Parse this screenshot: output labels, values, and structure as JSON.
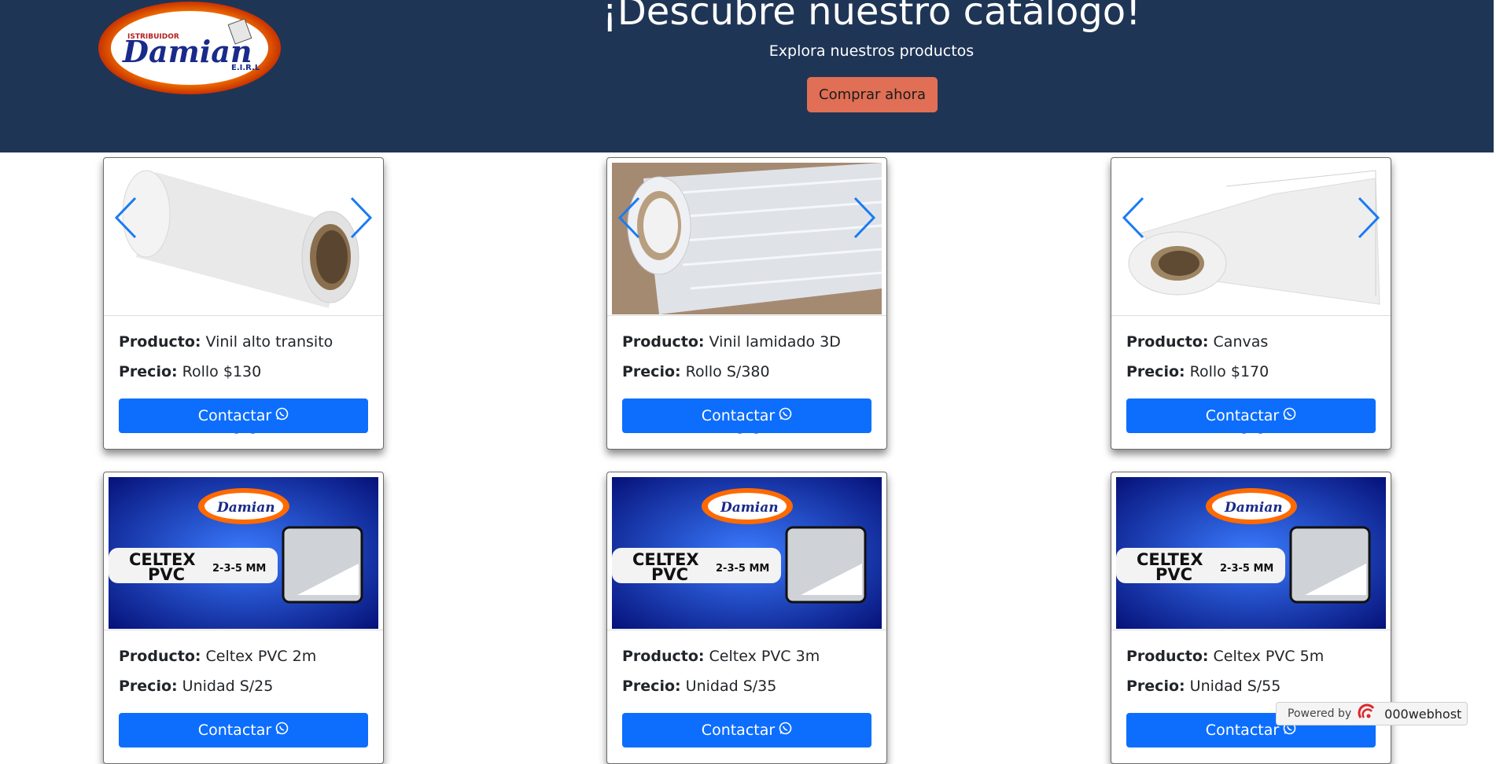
{
  "hero": {
    "title": "¡Descubre nuestro catálogo!",
    "subtitle": "Explora nuestros productos",
    "cta_label": "Comprar ahora",
    "logo_top": "ISTRIBUIDOR",
    "logo_main": "Damian",
    "logo_suffix": "E.I.R.L"
  },
  "labels": {
    "product": "Producto:",
    "price": "Precio:",
    "contact": "Contactar"
  },
  "products": [
    {
      "name": "Vinil alto transito",
      "price": "Rollo $130"
    },
    {
      "name": "Vinil lamidado 3D",
      "price": "Rollo S/380"
    },
    {
      "name": "Canvas",
      "price": "Rollo $170"
    },
    {
      "name": "Celtex PVC 2m",
      "price": "Unidad S/25"
    },
    {
      "name": "Celtex PVC 3m",
      "price": "Unidad S/35"
    },
    {
      "name": "Celtex PVC 5m",
      "price": "Unidad S/55"
    }
  ],
  "celtex_banner": {
    "brand": "Damian",
    "line1": "CELTEX",
    "line2": "PVC",
    "sizes": "2-3-5 MM"
  },
  "footer_badge": {
    "powered": "Powered by",
    "host": "000webhost"
  },
  "colors": {
    "hero_bg": "#1f3556",
    "cta_bg": "#e06f55",
    "contact_bg": "#0d6efd",
    "arrow": "#1a7bf2"
  }
}
